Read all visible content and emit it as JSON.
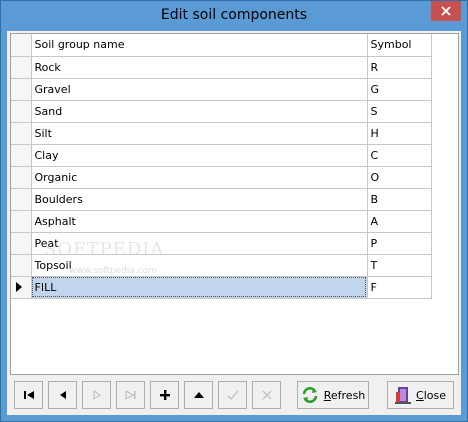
{
  "window": {
    "title": "Edit soil components"
  },
  "grid": {
    "headers": {
      "name": "Soil group name",
      "symbol": "Symbol"
    },
    "rows": [
      {
        "name": "Rock",
        "symbol": "R"
      },
      {
        "name": "Gravel",
        "symbol": "G"
      },
      {
        "name": "Sand",
        "symbol": "S"
      },
      {
        "name": "Silt",
        "symbol": "H"
      },
      {
        "name": "Clay",
        "symbol": "C"
      },
      {
        "name": "Organic",
        "symbol": "O"
      },
      {
        "name": "Boulders",
        "symbol": "B"
      },
      {
        "name": "Asphalt",
        "symbol": "A"
      },
      {
        "name": "Peat",
        "symbol": "P"
      },
      {
        "name": "Topsoil",
        "symbol": "T"
      },
      {
        "name": "FILL",
        "symbol": "F"
      }
    ],
    "selected_row_index": 10
  },
  "watermark": {
    "text": "SOFTPEDIA",
    "url": "www.softpedia.com"
  },
  "toolbar": {
    "nav_buttons": [
      "first-record",
      "prior-record",
      "next-record",
      "last-record",
      "insert-record",
      "post-edit",
      "edit-record",
      "cancel-edit"
    ],
    "refresh": {
      "accel": "R",
      "rest": "efresh"
    },
    "close": {
      "accel": "C",
      "rest": "lose"
    }
  },
  "colors": {
    "title_bar": "#5b9bd5",
    "close_button": "#c75050",
    "selection": "#c2d5ec"
  }
}
